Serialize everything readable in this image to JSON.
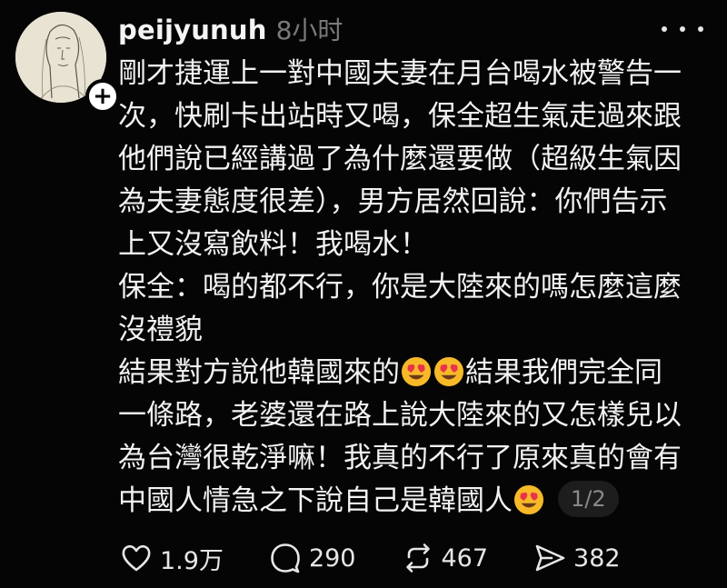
{
  "post": {
    "username": "peijyunuh",
    "timestamp": "8小时",
    "lines": [
      "剛才捷運上一對中國夫妻在月台喝水被警告一",
      "次，快刷卡出站時又喝，保全超生氣走過來跟",
      "他們說已經講過了為什麼還要做（超級生氣因",
      "為夫妻態度很差），男方居然回說：你們告示",
      "上又沒寫飲料！我喝水！",
      "保全：喝的都不行，你是大陸來的嗎怎麼這麼",
      "沒禮貌",
      "結果對方說他韓國來的",
      "結果我們完全同",
      "一條路，老婆還在路上說大陸來的又怎樣兒以",
      "為台灣很乾淨嘛！我真的不行了原來真的會有",
      "中國人情急之下說自己是韓國人"
    ],
    "emoji": "heart-eyes-emoji",
    "page_indicator": "1/2"
  },
  "actions": {
    "likes": "1.9万",
    "comments": "290",
    "reposts": "467",
    "shares": "382"
  },
  "icons": {
    "like": "heart-icon",
    "comment": "comment-bubble-icon",
    "repost": "repost-icon",
    "share": "send-icon",
    "more": "more-dots-icon",
    "follow": "plus-icon"
  },
  "colors": {
    "background": "#050505",
    "text": "#f2f2f2",
    "muted": "#7a7a7a",
    "emoji_face": "#f7b928",
    "emoji_heart": "#e8334a"
  }
}
